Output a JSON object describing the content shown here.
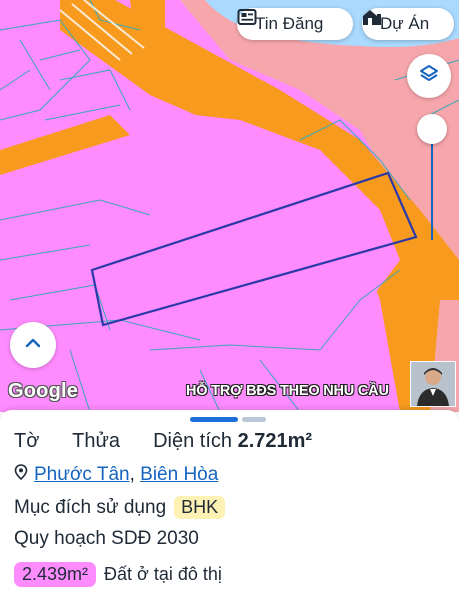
{
  "top_buttons": {
    "tin_dang": "Tin Đăng",
    "du_an": "Dự Án"
  },
  "map": {
    "attribution": "Google",
    "watermark": "HỖ TRỢ BĐS  THEO NHU CẦU",
    "colors": {
      "residential": "#ff8cff",
      "road": "#f79a1e",
      "water": "#aadaff",
      "urban_land": "#f7a7ac",
      "parcel_outline": "#2b3aa8"
    }
  },
  "parcel": {
    "to_label": "Tờ",
    "to_value": "",
    "thua_label": "Thửa",
    "thua_value": "",
    "area_label": "Diện tích",
    "area_value": "2.721m²",
    "ward": "Phước Tân",
    "separator": ",",
    "city": "Biên Hòa",
    "usage_label": "Mục đích sử dụng",
    "usage_code": "BHK",
    "plan_label": "Quy hoạch SDĐ 2030",
    "zones": [
      {
        "area": "2.439m²",
        "label": "Đất ở tại đô thị",
        "color": "#ff8cff"
      }
    ]
  },
  "icons": {
    "tin_dang": "news-icon",
    "du_an": "building-icon",
    "layers": "layers-icon",
    "expand": "chevron-up-icon",
    "location": "location-pin-icon"
  }
}
